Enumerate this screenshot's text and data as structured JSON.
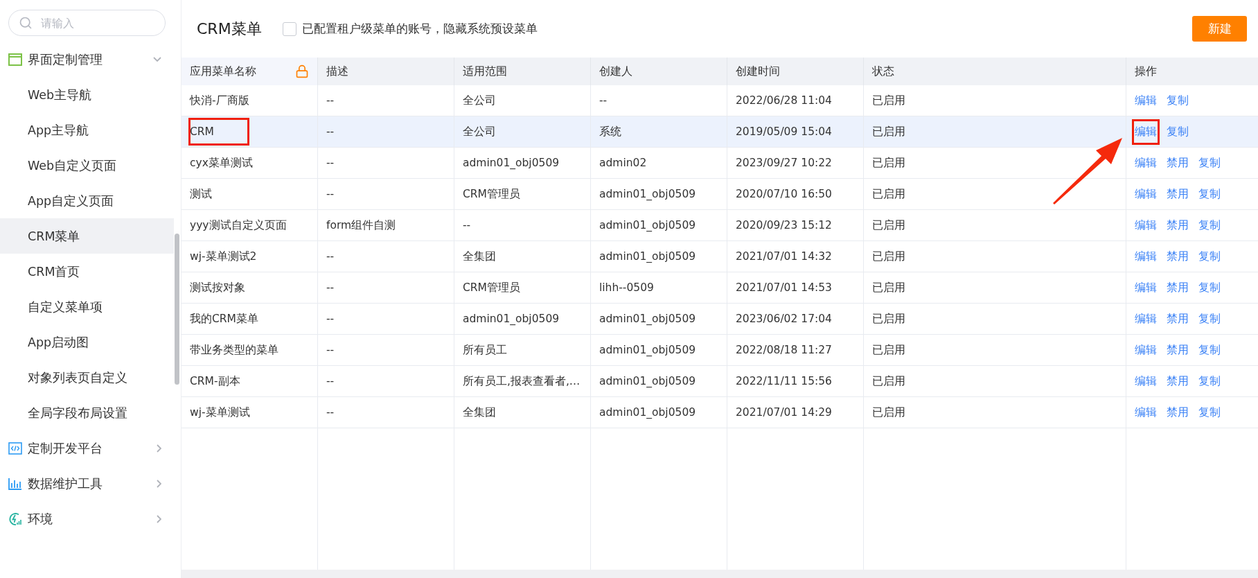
{
  "sidebar": {
    "search": {
      "placeholder": "请输入"
    },
    "groups": [
      {
        "label": "界面定制管理",
        "expanded": true,
        "children": [
          {
            "label": "Web主导航",
            "selected": false
          },
          {
            "label": "App主导航",
            "selected": false
          },
          {
            "label": "Web自定义页面",
            "selected": false
          },
          {
            "label": "App自定义页面",
            "selected": false
          },
          {
            "label": "CRM菜单",
            "selected": true
          },
          {
            "label": "CRM首页",
            "selected": false
          },
          {
            "label": "自定义菜单项",
            "selected": false
          },
          {
            "label": "App启动图",
            "selected": false
          },
          {
            "label": "对象列表页自定义",
            "selected": false
          },
          {
            "label": "全局字段布局设置",
            "selected": false
          }
        ]
      },
      {
        "label": "定制开发平台",
        "expanded": false
      },
      {
        "label": "数据维护工具",
        "expanded": false
      },
      {
        "label": "环境",
        "expanded": false
      }
    ]
  },
  "header": {
    "title": "CRM菜单",
    "hide_preset": {
      "label": "已配置租户级菜单的账号，隐藏系统预设菜单",
      "checked": false
    },
    "new_button": "新建"
  },
  "table": {
    "columns": [
      "应用菜单名称",
      "描述",
      "适用范围",
      "创建人",
      "创建时间",
      "状态",
      "操作"
    ],
    "rows": [
      {
        "cells": [
          "快消-厂商版",
          "--",
          "全公司",
          "--",
          "2022/06/28 11:04",
          "已启用"
        ],
        "actions": [
          "编辑",
          "复制"
        ],
        "selected": false,
        "name_highlighted": false,
        "edit_highlighted": false
      },
      {
        "cells": [
          "CRM",
          "--",
          "全公司",
          "系统",
          "2019/05/09 15:04",
          "已启用"
        ],
        "actions": [
          "编辑",
          "复制"
        ],
        "selected": true,
        "name_highlighted": true,
        "edit_highlighted": true
      },
      {
        "cells": [
          "cyx菜单测试",
          "--",
          "admin01_obj0509",
          "admin02",
          "2023/09/27 10:22",
          "已启用"
        ],
        "actions": [
          "编辑",
          "禁用",
          "复制"
        ],
        "selected": false,
        "name_highlighted": false,
        "edit_highlighted": false
      },
      {
        "cells": [
          "测试",
          "--",
          "CRM管理员",
          "admin01_obj0509",
          "2020/07/10 16:50",
          "已启用"
        ],
        "actions": [
          "编辑",
          "禁用",
          "复制"
        ],
        "selected": false,
        "name_highlighted": false,
        "edit_highlighted": false
      },
      {
        "cells": [
          "yyy测试自定义页面",
          "form组件自测",
          "--",
          "admin01_obj0509",
          "2020/09/23 15:12",
          "已启用"
        ],
        "actions": [
          "编辑",
          "禁用",
          "复制"
        ],
        "selected": false,
        "name_highlighted": false,
        "edit_highlighted": false
      },
      {
        "cells": [
          "wj-菜单测试2",
          "--",
          "全集团",
          "admin01_obj0509",
          "2021/07/01 14:32",
          "已启用"
        ],
        "actions": [
          "编辑",
          "禁用",
          "复制"
        ],
        "selected": false,
        "name_highlighted": false,
        "edit_highlighted": false
      },
      {
        "cells": [
          "测试按对象",
          "--",
          "CRM管理员",
          "lihh--0509",
          "2021/07/01 14:53",
          "已启用"
        ],
        "actions": [
          "编辑",
          "禁用",
          "复制"
        ],
        "selected": false,
        "name_highlighted": false,
        "edit_highlighted": false
      },
      {
        "cells": [
          "我的CRM菜单",
          "--",
          "admin01_obj0509",
          "admin01_obj0509",
          "2023/06/02 17:04",
          "已启用"
        ],
        "actions": [
          "编辑",
          "禁用",
          "复制"
        ],
        "selected": false,
        "name_highlighted": false,
        "edit_highlighted": false
      },
      {
        "cells": [
          "带业务类型的菜单",
          "--",
          "所有员工",
          "admin01_obj0509",
          "2022/08/18 11:27",
          "已启用"
        ],
        "actions": [
          "编辑",
          "禁用",
          "复制"
        ],
        "selected": false,
        "name_highlighted": false,
        "edit_highlighted": false
      },
      {
        "cells": [
          "CRM-副本",
          "--",
          "所有员工,报表查看者,…",
          "admin01_obj0509",
          "2022/11/11 15:56",
          "已启用"
        ],
        "actions": [
          "编辑",
          "禁用",
          "复制"
        ],
        "selected": false,
        "name_highlighted": false,
        "edit_highlighted": false
      },
      {
        "cells": [
          "wj-菜单测试",
          "--",
          "全集团",
          "admin01_obj0509",
          "2021/07/01 14:29",
          "已启用"
        ],
        "actions": [
          "编辑",
          "禁用",
          "复制"
        ],
        "selected": false,
        "name_highlighted": false,
        "edit_highlighted": false
      }
    ]
  }
}
